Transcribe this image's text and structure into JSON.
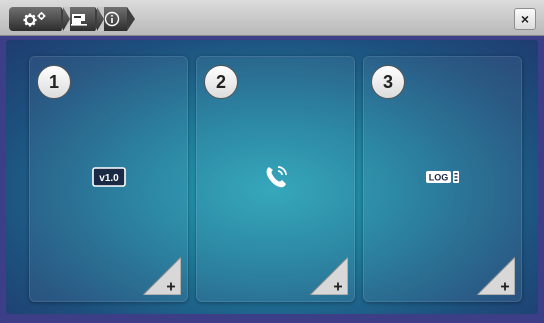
{
  "toolbar": {
    "breadcrumbs": [
      {
        "icon": "settings-gears-icon"
      },
      {
        "icon": "machine-icon"
      },
      {
        "icon": "info-icon"
      }
    ],
    "close_label": "×"
  },
  "tiles": [
    {
      "number": "1",
      "icon_label": "v1.0",
      "icon": "version-icon"
    },
    {
      "number": "2",
      "icon": "phone-icon"
    },
    {
      "number": "3",
      "icon_label": "LOG",
      "icon": "log-file-icon"
    }
  ],
  "colors": {
    "toolbar": "#c8c8c8",
    "frame": "#3c3f87",
    "content_center": "#2aa3b8",
    "content_edge": "#1f3c70"
  }
}
